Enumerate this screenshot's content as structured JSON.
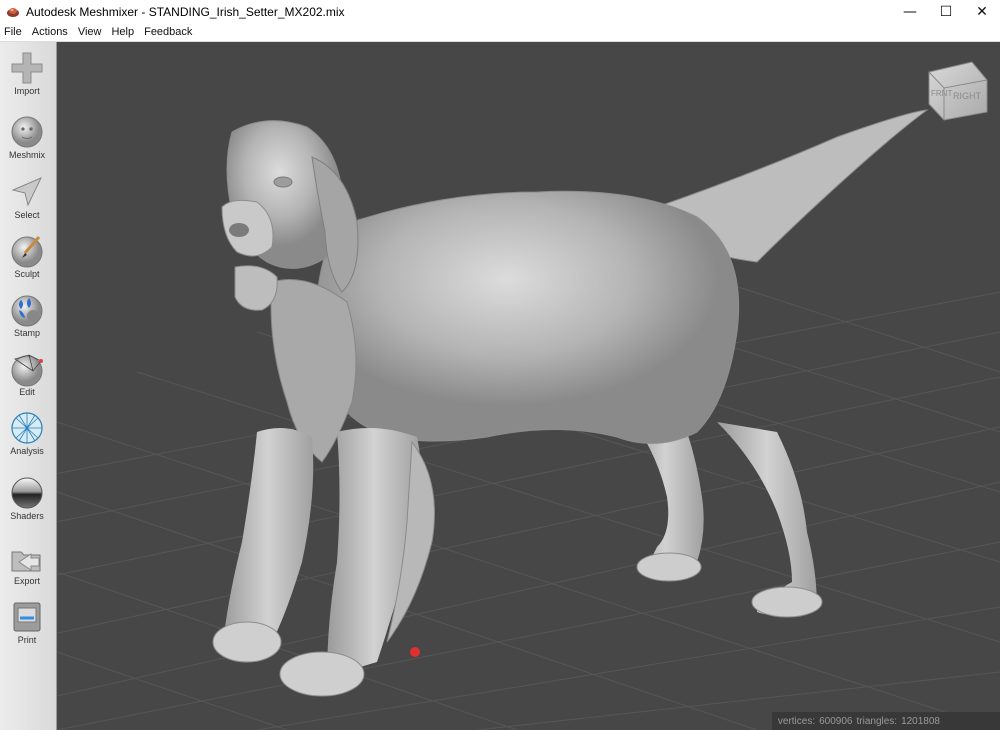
{
  "window": {
    "title": "Autodesk Meshmixer - STANDING_Irish_Setter_MX202.mix",
    "controls": {
      "minimize": "—",
      "maximize": "☐",
      "close": "✕"
    }
  },
  "menu": [
    "File",
    "Actions",
    "View",
    "Help",
    "Feedback"
  ],
  "tools": [
    {
      "label": "Import",
      "icon": "plus-icon"
    },
    {
      "label": "Meshmix",
      "icon": "face-ball-icon"
    },
    {
      "label": "Select",
      "icon": "cursor-arrow-icon"
    },
    {
      "label": "Sculpt",
      "icon": "brush-ball-icon"
    },
    {
      "label": "Stamp",
      "icon": "stamp-ball-icon"
    },
    {
      "label": "Edit",
      "icon": "wire-edit-ball-icon"
    },
    {
      "label": "Analysis",
      "icon": "wire-sphere-icon"
    },
    {
      "label": "Shaders",
      "icon": "chrome-sphere-icon"
    },
    {
      "label": "Export",
      "icon": "export-folder-icon"
    },
    {
      "label": "Print",
      "icon": "printer-icon"
    }
  ],
  "viewcube": {
    "front": "FRNT",
    "right": "RIGHT"
  },
  "status": {
    "vertices_label": "vertices:",
    "vertices": "600906",
    "triangles_label": "triangles:",
    "triangles": "1201808"
  },
  "colors": {
    "viewport_bg": "#474747",
    "grid": "#5a5a5a",
    "mesh": "#c4c4c4",
    "pivot": "#e03030"
  }
}
